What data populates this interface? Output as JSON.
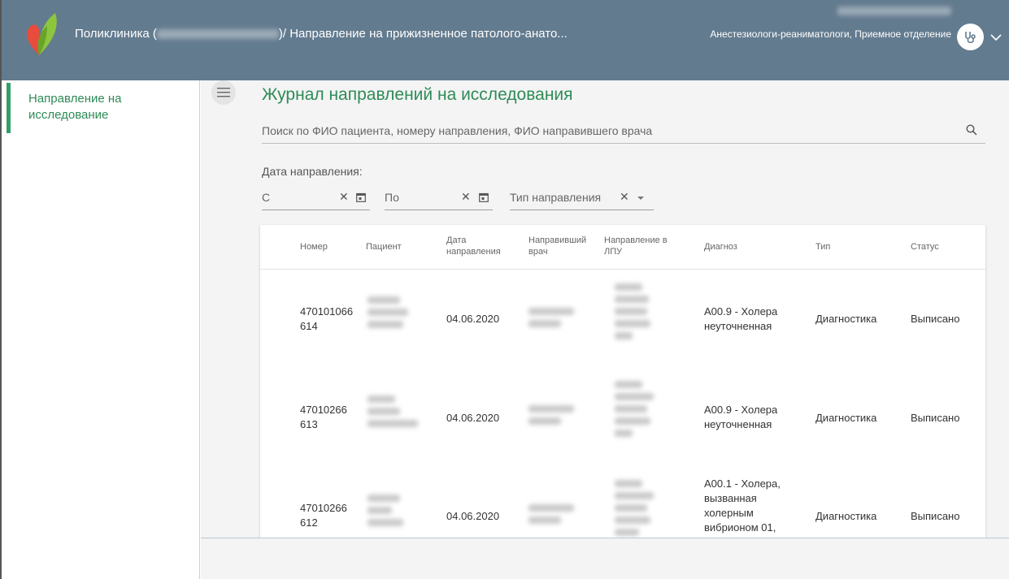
{
  "header": {
    "app_name": "Поликлиника (",
    "app_name_tail": ")/ Направление на прижизненное патолого-анато...",
    "user_department": "Анестезиологи-реаниматологи, Приемное отделение"
  },
  "sidebar": {
    "items": [
      {
        "label": "Направление на исследование"
      }
    ]
  },
  "main": {
    "title": "Журнал направлений на исследования",
    "search": {
      "placeholder": "Поиск по ФИО пациента, номеру направления, ФИО направившего врача",
      "value": ""
    },
    "filters": {
      "date_label": "Дата направления:",
      "from_label": "С",
      "to_label": "По",
      "type_label": "Тип направления"
    }
  },
  "table": {
    "columns": [
      "Номер",
      "Пациент",
      "Дата направления",
      "Направивший врач",
      "Направление в ЛПУ",
      "Диагноз",
      "Тип",
      "Статус"
    ],
    "rows": [
      {
        "number": "470101066614",
        "date": "04.06.2020",
        "diagnosis": "A00.9 - Холера неуточненная",
        "type": "Диагностика",
        "status": "Выписано"
      },
      {
        "number": "47010266613",
        "date": "04.06.2020",
        "diagnosis": "A00.9 - Холера неуточненная",
        "type": "Диагностика",
        "status": "Выписано"
      },
      {
        "number": "47010266612",
        "date": "04.06.2020",
        "diagnosis": "A00.1 - Холера, вызванная холерным вибрионом 01,",
        "type": "Диагностика",
        "status": "Выписано"
      }
    ]
  },
  "icons": {
    "logo": "heart-logo-icon",
    "menu": "hamburger-icon",
    "search": "search-icon",
    "calendar": "calendar-icon",
    "clear": "clear-icon",
    "dropdown": "chevron-down-icon",
    "role": "stethoscope-icon"
  },
  "colors": {
    "header_bg": "#637b8f",
    "accent_green": "#33a06b",
    "title_green": "#2e8b57",
    "main_bg": "#f4f4f4"
  }
}
